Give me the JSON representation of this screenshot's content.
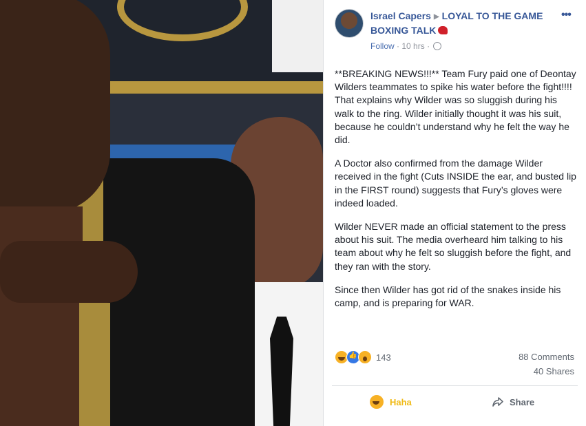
{
  "photo": {
    "alt_subject": ""
  },
  "header": {
    "author": "Israel Capers",
    "group_name": "LOYAL TO THE GAME",
    "group_name_line2": "BOXING TALK",
    "more": "•••",
    "follow": "Follow",
    "separator": "·",
    "time": "10 hrs",
    "separator2": "·"
  },
  "post": {
    "paragraphs": [
      "**BREAKING NEWS!!!** Team Fury paid one of Deontay Wilders teammates to spike his water before the fight!!!! That explains why Wilder was so sluggish during his walk to the ring. Wilder initially thought it was his suit, because he couldn’t understand why he felt the way he did.",
      "A Doctor also confirmed from the damage Wilder received in the fight (Cuts INSIDE the ear, and busted lip in the FIRST round) suggests that Fury’s gloves were indeed loaded.",
      "Wilder NEVER made an official statement to the press about his suit. The media overheard him talking to his team about why he felt so sluggish before the fight, and they ran with the story.",
      "Since then Wilder has got rid of the snakes inside his camp, and is preparing for WAR."
    ]
  },
  "stats": {
    "reaction_count": "143",
    "comments": "88 Comments",
    "shares": "40 Shares"
  },
  "actions": {
    "haha": "Haha",
    "share": "Share"
  },
  "colors": {
    "link": "#385898",
    "haha": "#f0ba15",
    "text": "#1d2129",
    "muted": "#606770"
  }
}
